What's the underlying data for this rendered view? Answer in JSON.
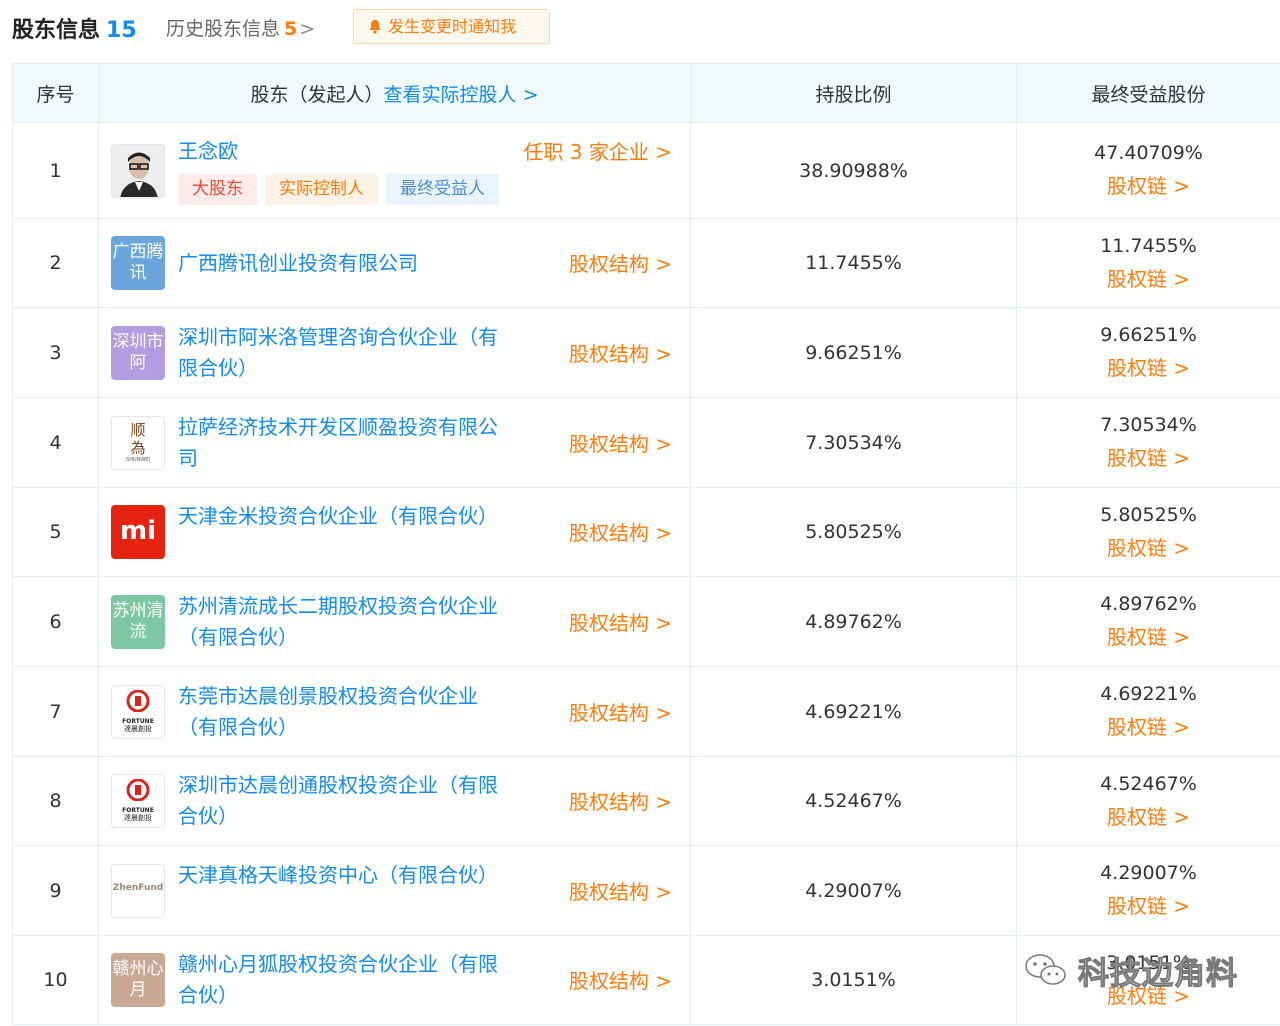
{
  "header": {
    "title": "股东信息",
    "title_count": "15",
    "history_label": "历史股东信息",
    "history_count": "5",
    "history_chevron": ">",
    "notify_label": "发生变更时通知我"
  },
  "table": {
    "col_no": "序号",
    "col_shareholder": "股东（发起人）",
    "col_controller_link": "查看实际控股人",
    "col_pct": "持股比例",
    "col_final": "最终受益股份",
    "chain_label": "股权链",
    "structure_label": "股权结构",
    "chevron": ">"
  },
  "rows": [
    {
      "no": "1",
      "name": "王念欧",
      "right": "任职 3 家企业",
      "tags": [
        "大股东",
        "实际控制人",
        "最终受益人"
      ],
      "pct": "38.90988%",
      "final": "47.40709%",
      "logo": "avatar-photo"
    },
    {
      "no": "2",
      "name": "广西腾讯创业投资有限公司",
      "right": "股权结构",
      "pct": "11.7455%",
      "final": "11.7455%",
      "logo_text": "广西腾讯",
      "logo_color": "#6aa6dc"
    },
    {
      "no": "3",
      "name": "深圳市阿米洛管理咨询合伙企业（有限合伙）",
      "right": "股权结构",
      "pct": "9.66251%",
      "final": "9.66251%",
      "logo_text": "深圳市阿",
      "logo_color": "#b39ce0"
    },
    {
      "no": "4",
      "name": "拉萨经济技术开发区顺盈投资有限公司",
      "right": "股权结构",
      "pct": "7.30534%",
      "final": "7.30534%",
      "logo_text": "顺為",
      "logo_sub": "SHUNWEI",
      "logo_color": "#ffffff"
    },
    {
      "no": "5",
      "name": "天津金米投资合伙企业（有限合伙）",
      "right": "股权结构",
      "pct": "5.80525%",
      "final": "5.80525%",
      "logo_text": "mi",
      "logo_color": "#e62211"
    },
    {
      "no": "6",
      "name": "苏州清流成长二期股权投资合伙企业（有限合伙）",
      "right": "股权结构",
      "pct": "4.89762%",
      "final": "4.89762%",
      "logo_text": "苏州清流",
      "logo_color": "#7dc7a5"
    },
    {
      "no": "7",
      "name": "东莞市达晨创景股权投资合伙企业（有限合伙）",
      "right": "股权结构",
      "pct": "4.69221%",
      "final": "4.69221%",
      "logo_text": "FORTUNE",
      "logo_sub": "達晨創投",
      "logo_color": "#ffffff"
    },
    {
      "no": "8",
      "name": "深圳市达晨创通股权投资企业（有限合伙）",
      "right": "股权结构",
      "pct": "4.52467%",
      "final": "4.52467%",
      "logo_text": "FORTUNE",
      "logo_sub": "達晨創投",
      "logo_color": "#ffffff"
    },
    {
      "no": "9",
      "name": "天津真格天峰投资中心（有限合伙）",
      "right": "股权结构",
      "pct": "4.29007%",
      "final": "4.29007%",
      "logo_text": "ZhenFund",
      "logo_color": "#ffffff"
    },
    {
      "no": "10",
      "name": "赣州心月狐股权投资合伙企业（有限合伙）",
      "right": "股权结构",
      "pct": "3.0151%",
      "final": "3.0151%",
      "logo_text": "赣州心月",
      "logo_color": "#c9a896"
    }
  ],
  "watermark": "科技边角料",
  "colors": {
    "blue": "#128bed",
    "orange": "#fd7d0c",
    "header_bg": "#f2f9fc",
    "border": "#e4eef6"
  }
}
